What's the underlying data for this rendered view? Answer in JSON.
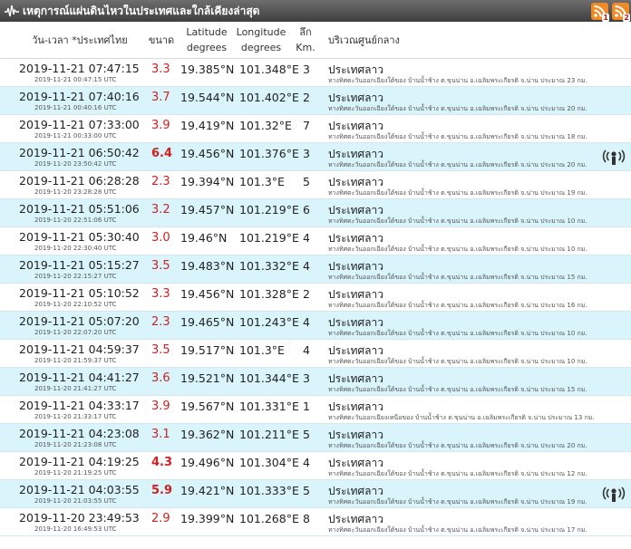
{
  "header": {
    "title": "เหตุการณ์แผ่นดินไหวในประเทศและใกล้เคียงล่าสุด",
    "rss": [
      "1",
      "2"
    ]
  },
  "columns": {
    "datetime": "วัน-เวลา *ประเทศไทย",
    "magnitude": "ขนาด",
    "latitude_1": "Latitude",
    "latitude_2": "degrees",
    "longitude_1": "Longitude",
    "longitude_2": "degrees",
    "depth_1": "ลึก",
    "depth_2": "Km.",
    "region": "บริเวณศูนย์กลาง"
  },
  "quakes": [
    {
      "datetime": "2019-11-21 07:47:15",
      "utc": "2019-11-21 00:47:15 UTC",
      "mag": "3.3",
      "lat": "19.385°N",
      "lon": "101.348°E",
      "depth": "3",
      "region": "ประเทศลาว",
      "location": "ทางทิศตะวันออกเฉียงใต้ของ บ้านน้ำช้าง ต.ขุนน่าน อ.เฉลิมพระเกียรติ จ.น่าน ประมาณ 23 กม."
    },
    {
      "datetime": "2019-11-21 07:40:16",
      "utc": "2019-11-21 00:40:16 UTC",
      "mag": "3.7",
      "lat": "19.544°N",
      "lon": "101.402°E",
      "depth": "2",
      "region": "ประเทศลาว",
      "location": "ทางทิศตะวันออกเฉียงใต้ของ บ้านน้ำช้าง ต.ขุนน่าน อ.เฉลิมพระเกียรติ จ.น่าน ประมาณ 20 กม."
    },
    {
      "datetime": "2019-11-21 07:33:00",
      "utc": "2019-11-21 00:33:00 UTC",
      "mag": "3.9",
      "lat": "19.419°N",
      "lon": "101.32°E",
      "depth": "7",
      "region": "ประเทศลาว",
      "location": "ทางทิศตะวันออกเฉียงใต้ของ บ้านน้ำช้าง ต.ขุนน่าน อ.เฉลิมพระเกียรติ จ.น่าน ประมาณ 18 กม."
    },
    {
      "datetime": "2019-11-21 06:50:42",
      "utc": "2019-11-20 23:50:42 UTC",
      "mag": "6.4",
      "lat": "19.456°N",
      "lon": "101.376°E",
      "depth": "3",
      "region": "ประเทศลาว",
      "location": "ทางทิศตะวันออกเฉียงใต้ของ บ้านน้ำช้าง ต.ขุนน่าน อ.เฉลิมพระเกียรติ จ.น่าน ประมาณ 20 กม.",
      "felt": true
    },
    {
      "datetime": "2019-11-21 06:28:28",
      "utc": "2019-11-20 23:28:28 UTC",
      "mag": "2.3",
      "lat": "19.394°N",
      "lon": "101.3°E",
      "depth": "5",
      "region": "ประเทศลาว",
      "location": "ทางทิศตะวันออกเฉียงใต้ของ บ้านน้ำช้าง ต.ขุนน่าน อ.เฉลิมพระเกียรติ จ.น่าน ประมาณ 19 กม."
    },
    {
      "datetime": "2019-11-21 05:51:06",
      "utc": "2019-11-20 22:51:06 UTC",
      "mag": "3.2",
      "lat": "19.457°N",
      "lon": "101.219°E",
      "depth": "6",
      "region": "ประเทศลาว",
      "location": "ทางทิศตะวันออกเฉียงใต้ของ บ้านน้ำช้าง ต.ขุนน่าน อ.เฉลิมพระเกียรติ จ.น่าน ประมาณ 10 กม."
    },
    {
      "datetime": "2019-11-21 05:30:40",
      "utc": "2019-11-20 22:30:40 UTC",
      "mag": "3.0",
      "lat": "19.46°N",
      "lon": "101.219°E",
      "depth": "4",
      "region": "ประเทศลาว",
      "location": "ทางทิศตะวันออกเฉียงใต้ของ บ้านน้ำช้าง ต.ขุนน่าน อ.เฉลิมพระเกียรติ จ.น่าน ประมาณ 10 กม."
    },
    {
      "datetime": "2019-11-21 05:15:27",
      "utc": "2019-11-20 22:15:27 UTC",
      "mag": "3.5",
      "lat": "19.483°N",
      "lon": "101.332°E",
      "depth": "4",
      "region": "ประเทศลาว",
      "location": "ทางทิศตะวันออกเฉียงใต้ของ บ้านน้ำช้าง ต.ขุนน่าน อ.เฉลิมพระเกียรติ จ.น่าน ประมาณ 15 กม."
    },
    {
      "datetime": "2019-11-21 05:10:52",
      "utc": "2019-11-20 22:10:52 UTC",
      "mag": "3.3",
      "lat": "19.456°N",
      "lon": "101.328°E",
      "depth": "2",
      "region": "ประเทศลาว",
      "location": "ทางทิศตะวันออกเฉียงใต้ของ บ้านน้ำช้าง ต.ขุนน่าน อ.เฉลิมพระเกียรติ จ.น่าน ประมาณ 16 กม."
    },
    {
      "datetime": "2019-11-21 05:07:20",
      "utc": "2019-11-20 22:07:20 UTC",
      "mag": "2.3",
      "lat": "19.465°N",
      "lon": "101.243°E",
      "depth": "4",
      "region": "ประเทศลาว",
      "location": "ทางทิศตะวันออกเฉียงใต้ของ บ้านน้ำช้าง ต.ขุนน่าน อ.เฉลิมพระเกียรติ จ.น่าน ประมาณ 10 กม."
    },
    {
      "datetime": "2019-11-21 04:59:37",
      "utc": "2019-11-20 21:59:37 UTC",
      "mag": "3.5",
      "lat": "19.517°N",
      "lon": "101.3°E",
      "depth": "4",
      "region": "ประเทศลาว",
      "location": "ทางทิศตะวันออกเฉียงใต้ของ บ้านน้ำช้าง ต.ขุนน่าน อ.เฉลิมพระเกียรติ จ.น่าน ประมาณ 10 กม."
    },
    {
      "datetime": "2019-11-21 04:41:27",
      "utc": "2019-11-20 21:41:27 UTC",
      "mag": "3.6",
      "lat": "19.521°N",
      "lon": "101.344°E",
      "depth": "3",
      "region": "ประเทศลาว",
      "location": "ทางทิศตะวันออกเฉียงใต้ของ บ้านน้ำช้าง ต.ขุนน่าน อ.เฉลิมพระเกียรติ จ.น่าน ประมาณ 15 กม."
    },
    {
      "datetime": "2019-11-21 04:33:17",
      "utc": "2019-11-20 21:33:17 UTC",
      "mag": "3.9",
      "lat": "19.567°N",
      "lon": "101.331°E",
      "depth": "1",
      "region": "ประเทศลาว",
      "location": "ทางทิศตะวันออกเฉียงเหนือของ บ้านน้ำช้าง ต.ขุนน่าน อ.เฉลิมพระเกียรติ จ.น่าน ประมาณ 13 กม."
    },
    {
      "datetime": "2019-11-21 04:23:08",
      "utc": "2019-11-20 21:23:08 UTC",
      "mag": "3.1",
      "lat": "19.362°N",
      "lon": "101.211°E",
      "depth": "5",
      "region": "ประเทศลาว",
      "location": "ทางทิศตะวันออกเฉียงใต้ของ บ้านน้ำช้าง ต.ขุนน่าน อ.เฉลิมพระเกียรติ จ.น่าน ประมาณ 20 กม."
    },
    {
      "datetime": "2019-11-21 04:19:25",
      "utc": "2019-11-20 21:19:25 UTC",
      "mag": "4.3",
      "lat": "19.496°N",
      "lon": "101.304°E",
      "depth": "4",
      "region": "ประเทศลาว",
      "location": "ทางทิศตะวันออกเฉียงใต้ของ บ้านน้ำช้าง ต.ขุนน่าน อ.เฉลิมพระเกียรติ จ.น่าน ประมาณ 12 กม."
    },
    {
      "datetime": "2019-11-21 04:03:55",
      "utc": "2019-11-20 21:03:55 UTC",
      "mag": "5.9",
      "lat": "19.421°N",
      "lon": "101.333°E",
      "depth": "5",
      "region": "ประเทศลาว",
      "location": "ทางทิศตะวันออกเฉียงใต้ของ บ้านน้ำช้าง ต.ขุนน่าน อ.เฉลิมพระเกียรติ จ.น่าน ประมาณ 19 กม.",
      "felt": true
    },
    {
      "datetime": "2019-11-20 23:49:53",
      "utc": "2019-11-20 16:49:53 UTC",
      "mag": "2.9",
      "lat": "19.399°N",
      "lon": "101.268°E",
      "depth": "8",
      "region": "ประเทศลาว",
      "location": "ทางทิศตะวันออกเฉียงใต้ของ บ้านน้ำช้าง ต.ขุนน่าน อ.เฉลิมพระเกียรติ จ.น่าน ประมาณ 17 กม."
    }
  ]
}
